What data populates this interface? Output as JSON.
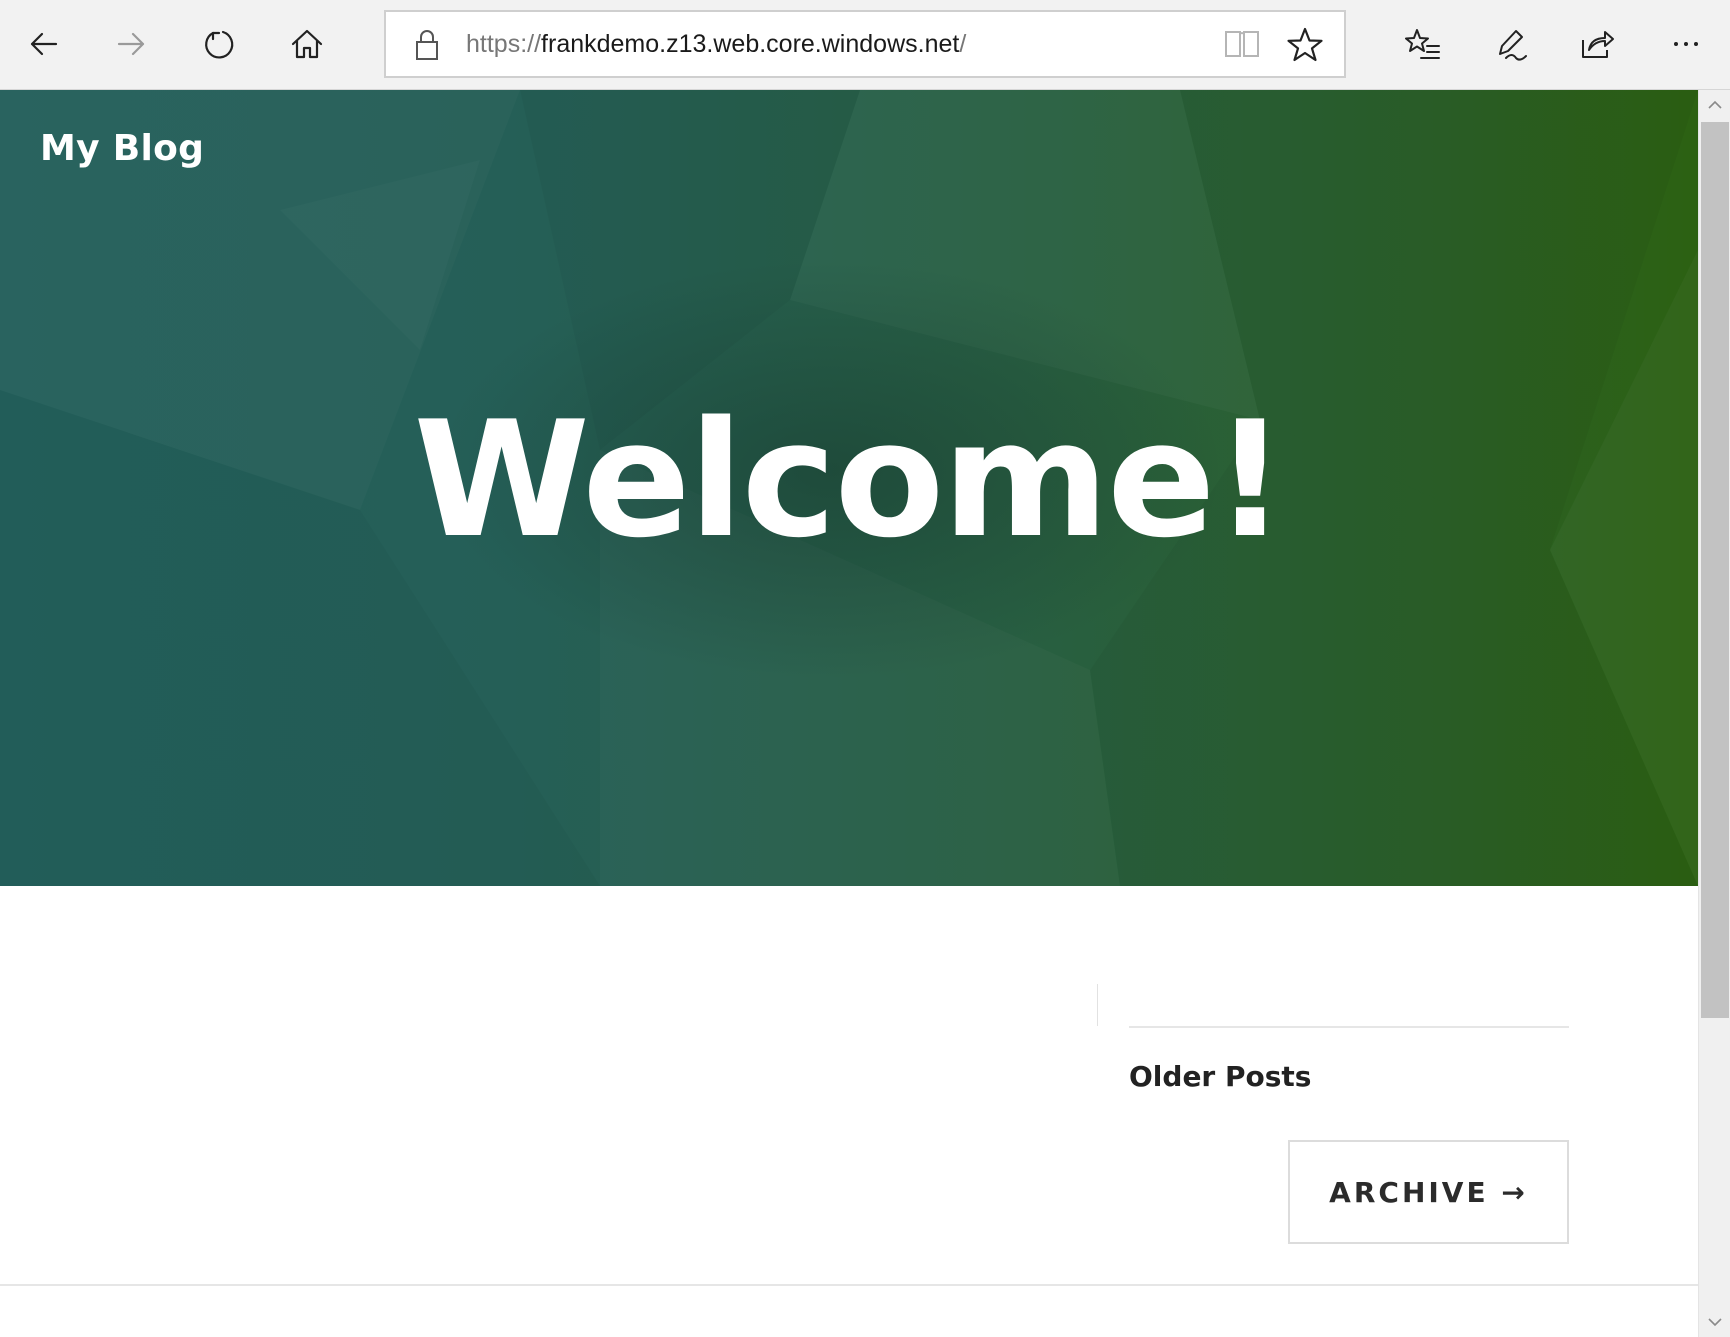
{
  "browser": {
    "url_scheme": "https://",
    "url_host": "frankdemo.z13.web.core.windows.net",
    "url_tail": "/",
    "icons": {
      "back": "back-arrow-icon",
      "forward": "forward-arrow-icon",
      "refresh": "refresh-icon",
      "home": "home-icon",
      "lock": "lock-icon",
      "reader": "reading-view-icon",
      "favorite": "star-icon",
      "favorites_hub": "favorites-list-icon",
      "notes": "pen-icon",
      "share": "share-icon",
      "more": "more-dots-icon"
    }
  },
  "site": {
    "title": "My Blog"
  },
  "hero": {
    "heading": "Welcome!",
    "colors": {
      "left": "#24605c",
      "right": "#2c6112"
    }
  },
  "sidebar": {
    "widget_title": "Older Posts",
    "archive_label": "ARCHIVE →"
  }
}
